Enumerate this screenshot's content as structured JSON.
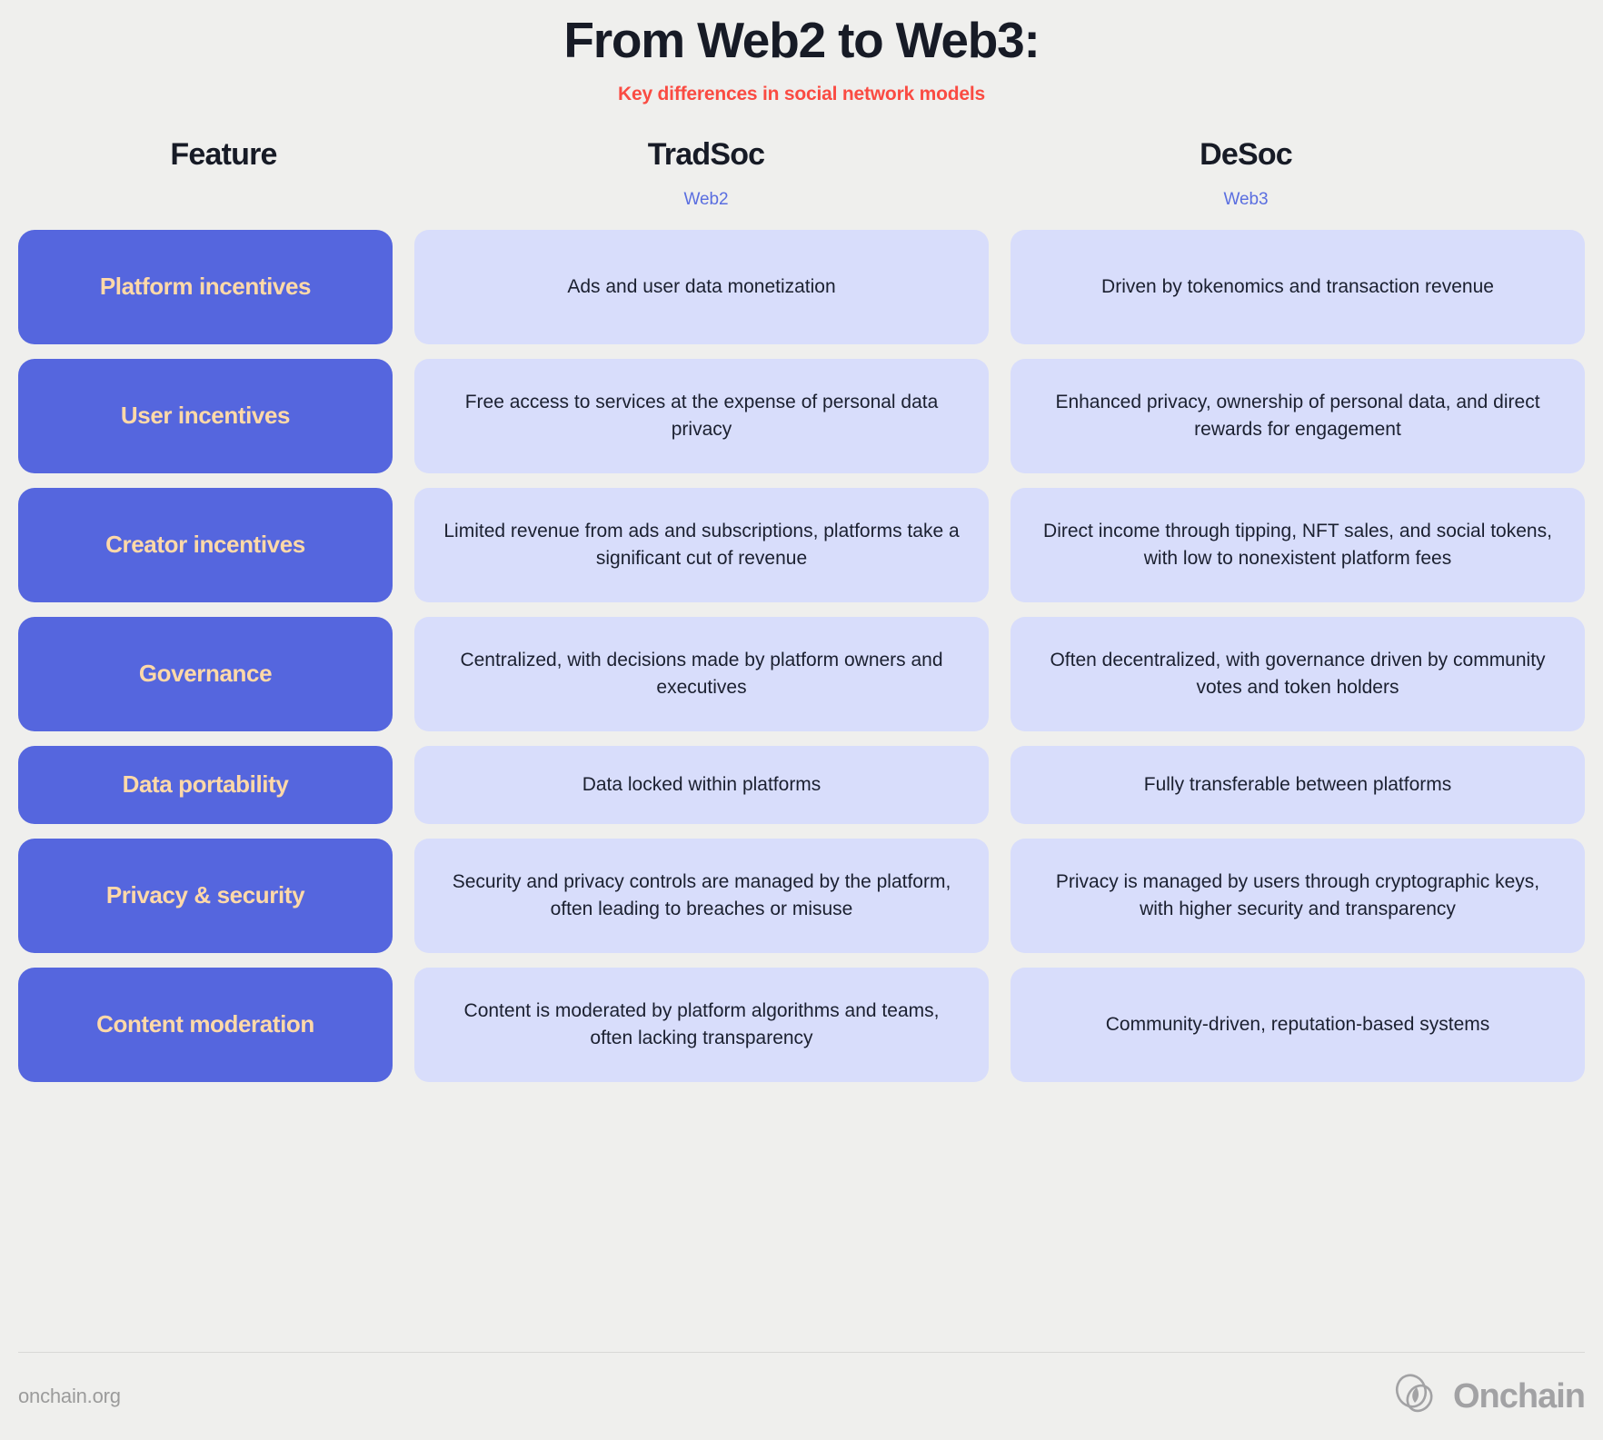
{
  "header": {
    "title": "From Web2 to Web3:",
    "subtitle": "Key differences in social network models",
    "accent_red": "#fa4b42"
  },
  "columns": [
    {
      "title": "Feature",
      "sub": ""
    },
    {
      "title": "TradSoc",
      "sub": "Web2"
    },
    {
      "title": "DeSoc",
      "sub": "Web3"
    }
  ],
  "colors": {
    "background": "#efefed",
    "feature_cell_bg": "#5566de",
    "feature_cell_text": "#ffd9a8",
    "value_cell_bg": "#d8ddfb",
    "value_cell_text": "#1b2030",
    "sub_label": "#5a6ee0",
    "footer_text": "#9b9b9b"
  },
  "rows": [
    {
      "feature": "Platform incentives",
      "tradsoc": "Ads and user data monetization",
      "desoc": "Driven by tokenomics and transaction revenue"
    },
    {
      "feature": "User incentives",
      "tradsoc": "Free access to services at the expense of personal data privacy",
      "desoc": "Enhanced privacy, ownership of personal data, and direct rewards for engagement"
    },
    {
      "feature": "Creator incentives",
      "tradsoc": "Limited revenue from ads and subscriptions, platforms take a significant cut of revenue",
      "desoc": "Direct income through tipping, NFT sales, and social tokens, with low to nonexistent platform fees"
    },
    {
      "feature": "Governance",
      "tradsoc": "Centralized, with decisions made by platform owners and executives",
      "desoc": "Often decentralized, with governance driven by community votes and token holders"
    },
    {
      "feature": "Data portability",
      "tradsoc": "Data locked within platforms",
      "desoc": "Fully transferable between platforms"
    },
    {
      "feature": "Privacy & security",
      "tradsoc": "Security and privacy controls are managed by the platform, often leading to breaches or misuse",
      "desoc": "Privacy is managed by users through cryptographic keys, with higher security and transparency"
    },
    {
      "feature": "Content moderation",
      "tradsoc": "Content is moderated by platform algorithms and teams, often lacking transparency",
      "desoc": "Community-driven, reputation-based systems"
    }
  ],
  "footer": {
    "url": "onchain.org",
    "brand_name": "Onchain",
    "brand_mark": "onchain-knot-logo-icon"
  }
}
